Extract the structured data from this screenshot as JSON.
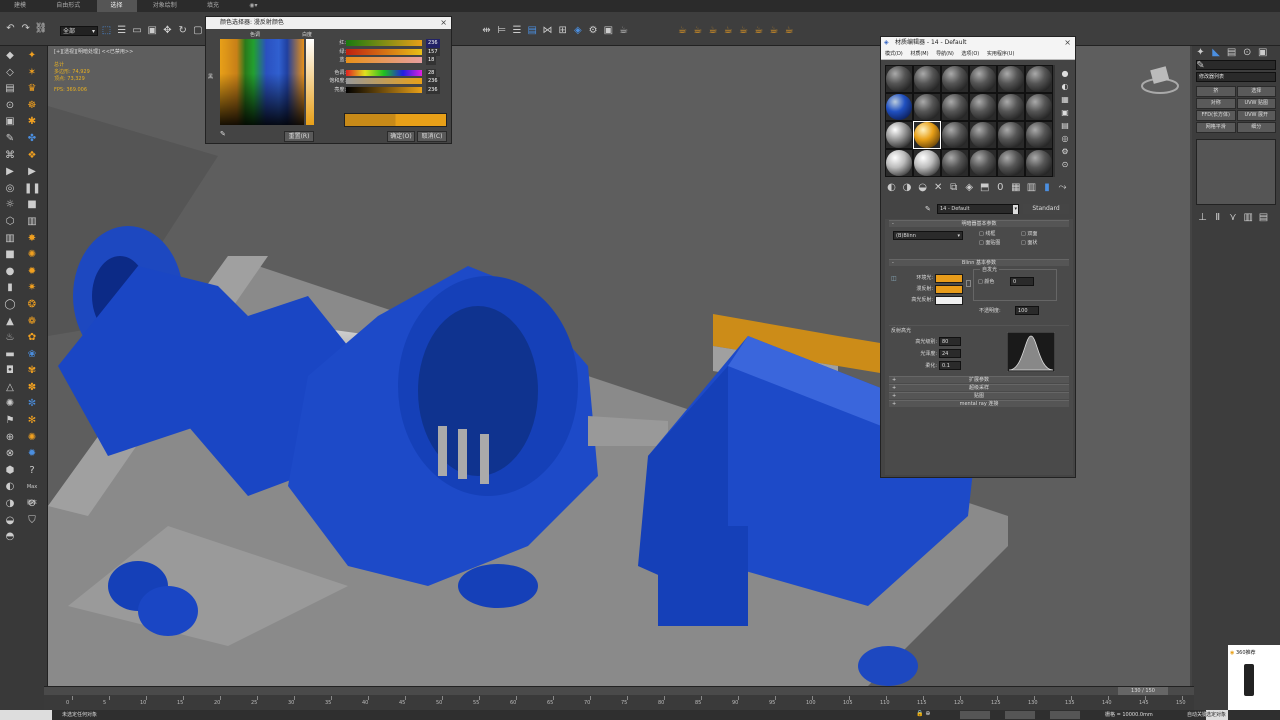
{
  "menu": {
    "items": [
      "建模",
      "自由形式",
      "选择",
      "对象绘制",
      "填充"
    ]
  },
  "toolbar": {
    "selection_filter": "全部"
  },
  "viewport": {
    "label": "[+][透视][明暗处理]",
    "sub": "<<已禁用>>",
    "stats": {
      "labels": [
        "总计",
        "多边形:",
        "顶点:",
        "FPS:"
      ],
      "values": [
        "74,929",
        "73,329",
        "369.006"
      ]
    }
  },
  "color_dialog": {
    "title": "颜色选择器: 漫反射颜色",
    "hue_label": "色调",
    "white_label": "白度",
    "black_label": "黑",
    "rows": [
      {
        "label": "红:",
        "value": "236"
      },
      {
        "label": "绿:",
        "value": "157"
      },
      {
        "label": "蓝:",
        "value": "18"
      },
      {
        "label": "色调:",
        "value": "28"
      },
      {
        "label": "饱和度:",
        "value": "236"
      },
      {
        "label": "亮度:",
        "value": "236"
      }
    ],
    "reset": "重置(R)",
    "ok": "确定(O)",
    "cancel": "取消(C)"
  },
  "mat_editor": {
    "title": "材质编辑器 - 14 - Default",
    "menu": [
      "模式(D)",
      "材质(M)",
      "导航(N)",
      "选项(O)",
      "实用程序(U)"
    ],
    "mat_name": "14 - Default",
    "mat_type": "Standard",
    "shader_section": "明暗器基本参数",
    "shader": "(B)Blinn",
    "opts": [
      "线框",
      "双面",
      "面贴图",
      "面状"
    ],
    "blinn_section": "Blinn 基本参数",
    "self_illum": "自发光",
    "color_lbl": "颜色",
    "color_val": "0",
    "ambient": "环境光:",
    "diffuse": "漫反射:",
    "specular": "高光反射:",
    "opacity": "不透明度:",
    "opacity_val": "100",
    "spec_section": "反射高光",
    "spec_level": "高光级别:",
    "spec_level_val": "80",
    "gloss": "光泽度:",
    "gloss_val": "24",
    "soften": "柔化:",
    "soften_val": "0.1",
    "rollouts": [
      "扩展参数",
      "超级采样",
      "贴图",
      "mental ray 连接"
    ],
    "colors": {
      "ambient": "#e89c1a",
      "diffuse": "#e89c1a",
      "specular": "#f0f0f0"
    }
  },
  "right_panel": {
    "modifier_list": "修改器列表",
    "buttons": [
      "挤",
      "选择",
      "对称",
      "UVW 贴图",
      "FFD(长方体)",
      "UVW 展开",
      "网格平滑",
      "细分"
    ]
  },
  "timeline": {
    "frame": "130 / 150",
    "ticks": [
      "0",
      "5",
      "10",
      "15",
      "20",
      "25",
      "30",
      "35",
      "40",
      "45",
      "50",
      "55",
      "60",
      "65",
      "70",
      "75",
      "80",
      "85",
      "90",
      "95",
      "100",
      "105",
      "110",
      "115",
      "120",
      "125",
      "130",
      "135",
      "140",
      "145",
      "150"
    ]
  },
  "status": {
    "left": "未选定任何对象",
    "grid": "栅格 = 10000.0mm",
    "auto": "自动关键点",
    "sel": "选定对象"
  },
  "notify": {
    "text": "360推荐"
  },
  "maxscript": {
    "label": "Max 脚本"
  }
}
